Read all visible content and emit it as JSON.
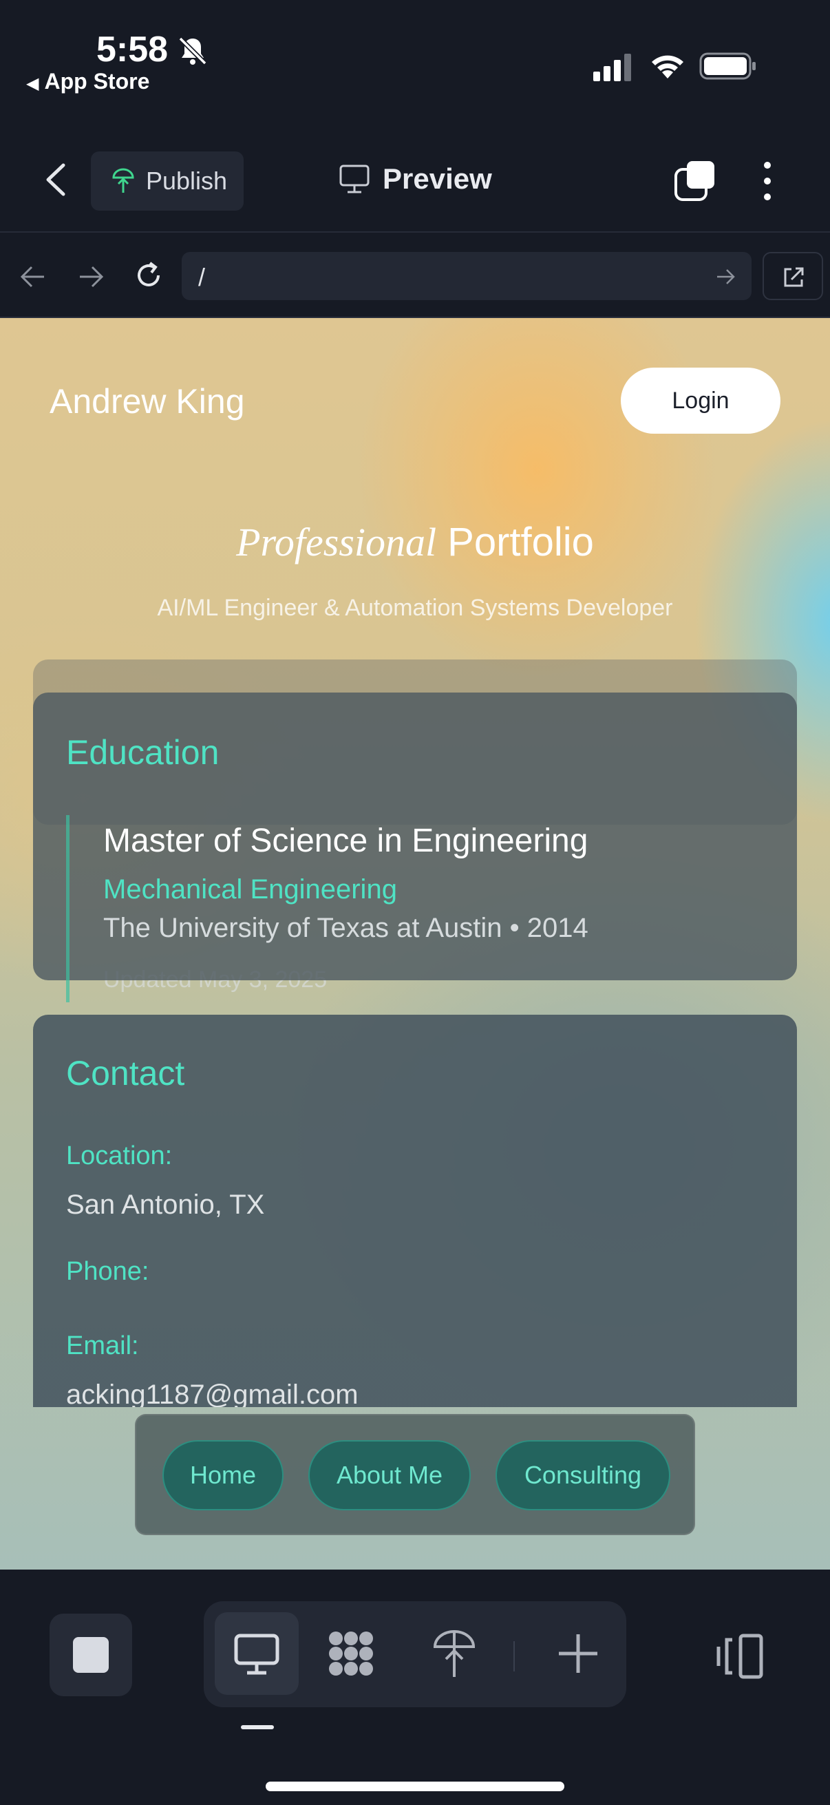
{
  "status_bar": {
    "time": "5:58",
    "back_app": "App Store",
    "bell_icon": "bell-slash-icon",
    "signal_icon": "cellular-signal-icon",
    "wifi_icon": "wifi-icon",
    "battery_icon": "battery-icon"
  },
  "header": {
    "publish_label": "Publish",
    "title": "Preview"
  },
  "browser": {
    "url": "/"
  },
  "site": {
    "name": "Andrew King",
    "login_label": "Login",
    "hero_title_italic": "Professional",
    "hero_title_rest": "Portfolio",
    "hero_subtitle": "AI/ML Engineer & Automation Systems Developer",
    "education": {
      "title": "Education",
      "degree": "Master of Science in Engineering",
      "major": "Mechanical Engineering",
      "school_year": "The University of Texas at Austin • 2014",
      "updated": "Updated May 3, 2025"
    },
    "contact": {
      "title": "Contact",
      "location_label": "Location:",
      "location_value": "San Antonio, TX",
      "phone_label": "Phone:",
      "email_label": "Email:",
      "email_value": "acking1187@gmail.com"
    },
    "nav": [
      "Home",
      "About Me",
      "Consulting"
    ]
  },
  "toolbar": {
    "icons": [
      "stop-icon",
      "desktop-icon",
      "grid-dots-icon",
      "publish-icon",
      "plus-icon",
      "panel-icon"
    ]
  },
  "colors": {
    "accent": "#4fe3c4",
    "background": "#161a24",
    "nav_button": "#23645e"
  }
}
